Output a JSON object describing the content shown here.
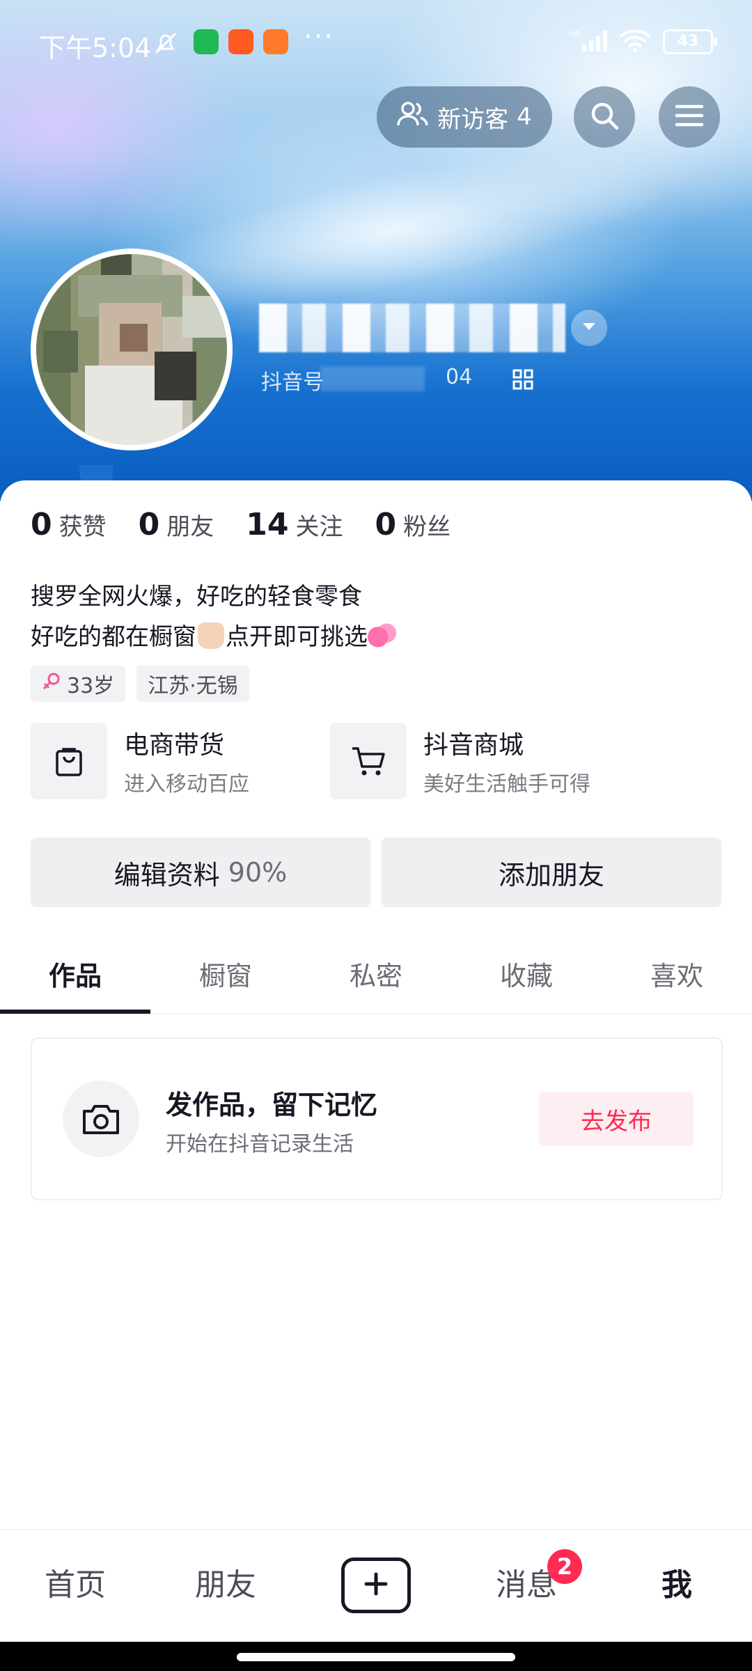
{
  "status_bar": {
    "time": "下午5:04",
    "battery": "43",
    "overflow": "···"
  },
  "header": {
    "visitor_label": "新访客",
    "visitor_count": "4",
    "douyin_id_label": "抖音号",
    "douyin_id_visible_tail": "04"
  },
  "stats": [
    {
      "value": "0",
      "label": "获赞"
    },
    {
      "value": "0",
      "label": "朋友"
    },
    {
      "value": "14",
      "label": "关注"
    },
    {
      "value": "0",
      "label": "粉丝"
    }
  ],
  "bio": {
    "line1": "搜罗全网火爆，好吃的轻食零食",
    "line2_a": "好吃的都在橱窗",
    "line2_b": "点开即可挑选"
  },
  "tags": {
    "age": "33岁",
    "location": "江苏·无锡"
  },
  "services": [
    {
      "title": "电商带货",
      "subtitle": "进入移动百应",
      "icon": "shopping-bag-icon"
    },
    {
      "title": "抖音商城",
      "subtitle": "美好生活触手可得",
      "icon": "cart-icon"
    }
  ],
  "actions": {
    "edit_profile": "编辑资料",
    "edit_profile_pct": "90%",
    "add_friend": "添加朋友"
  },
  "tabs": [
    "作品",
    "橱窗",
    "私密",
    "收藏",
    "喜欢"
  ],
  "post_prompt": {
    "title": "发作品，留下记忆",
    "subtitle": "开始在抖音记录生活",
    "button": "去发布"
  },
  "bottom_nav": {
    "home": "首页",
    "friends": "朋友",
    "messages": "消息",
    "messages_badge": "2",
    "me": "我"
  },
  "colors": {
    "accent": "#fe2c55",
    "text_primary": "#161823",
    "header_blue": "#1670cf"
  }
}
